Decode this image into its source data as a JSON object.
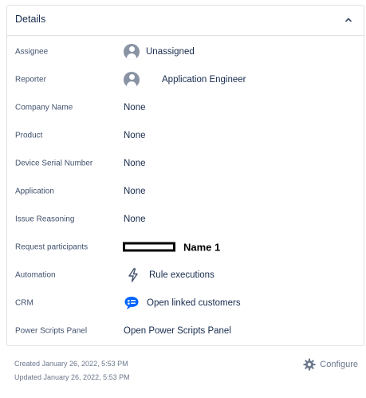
{
  "panel": {
    "title": "Details"
  },
  "fields": [
    {
      "label": "Assignee",
      "value": "Unassigned",
      "kind": "user"
    },
    {
      "label": "Reporter",
      "value": "Application Engineer",
      "kind": "user"
    },
    {
      "label": "Company Name",
      "value": "None",
      "kind": "none"
    },
    {
      "label": "Product",
      "value": "None",
      "kind": "none"
    },
    {
      "label": "Device Serial Number",
      "value": "None",
      "kind": "none"
    },
    {
      "label": "Application",
      "value": "None",
      "kind": "none"
    },
    {
      "label": "Issue Reasoning",
      "value": "None",
      "kind": "none"
    },
    {
      "label": "Request participants",
      "value": "Name 1",
      "kind": "participant"
    },
    {
      "label": "Automation",
      "value": "Rule executions",
      "kind": "automation"
    },
    {
      "label": "CRM",
      "value": "Open linked customers",
      "kind": "crm"
    },
    {
      "label": "Power Scripts Panel",
      "value": "Open Power Scripts Panel",
      "kind": "link"
    }
  ],
  "footer": {
    "created": "Created January 26, 2022, 5:53 PM",
    "updated": "Updated January 26, 2022, 5:53 PM",
    "configure_label": "Configure"
  },
  "icons": {
    "collapse": "chevron-up-icon",
    "avatar": "user-avatar-icon",
    "automation": "lightning-bolt-icon",
    "crm": "chat-bubble-icon",
    "configure": "gear-icon"
  },
  "colors": {
    "crm_icon": "#0065ff",
    "border": "#dfe1e6",
    "avatar": "#8993a4"
  }
}
